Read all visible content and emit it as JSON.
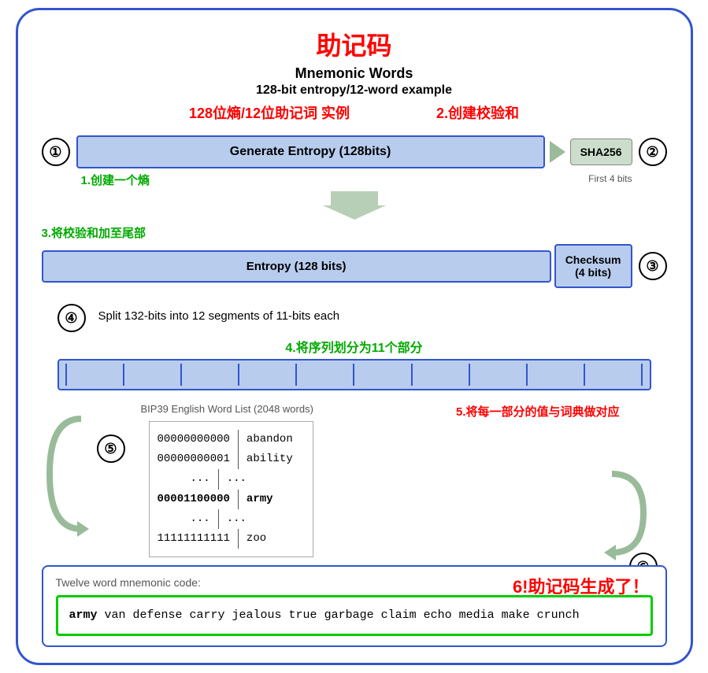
{
  "title": {
    "zh": "助记码",
    "en1": "Mnemonic Words",
    "en2": "128-bit entropy/12-word example",
    "zh2": "128位熵/12位助记词 实例"
  },
  "annotations": {
    "a1": "1.创建一个熵",
    "a2": "2.创建校验和",
    "a3": "3.将校验和加至尾部",
    "a4": "4.将序列划分为11个部分",
    "a5": "5.将每一部分的值与词典做对应",
    "a6": "6!助记码生成了！"
  },
  "step1": {
    "num": "①",
    "label": "Generate Entropy (128bits)",
    "sha_label": "SHA256",
    "first4bits": "First 4 bits",
    "num2": "②"
  },
  "step3": {
    "label3": "Entropy (128 bits)",
    "checksum_label": "Checksum",
    "checksum_bits": "(4 bits)",
    "num3": "③"
  },
  "step4": {
    "description": "Split 132-bits into 12 segments of 11-bits each",
    "num4": "④"
  },
  "bip39": {
    "title": "BIP39 English Word List (2048 words)",
    "rows": [
      {
        "binary": "00000000000",
        "word": "abandon"
      },
      {
        "binary": "00000000001",
        "word": "ability"
      },
      {
        "binary": "...",
        "word": "..."
      },
      {
        "binary": "00001100000",
        "word": "army",
        "bold": true
      },
      {
        "binary": "...",
        "word": "..."
      },
      {
        "binary": "11111111111",
        "word": "zoo"
      }
    ]
  },
  "step6": {
    "prefix_label": "Twelve word mnemonic code:",
    "mnemonic_bold": "army",
    "mnemonic_rest": " van defense carry jealous true garbage claim echo media make crunch"
  }
}
